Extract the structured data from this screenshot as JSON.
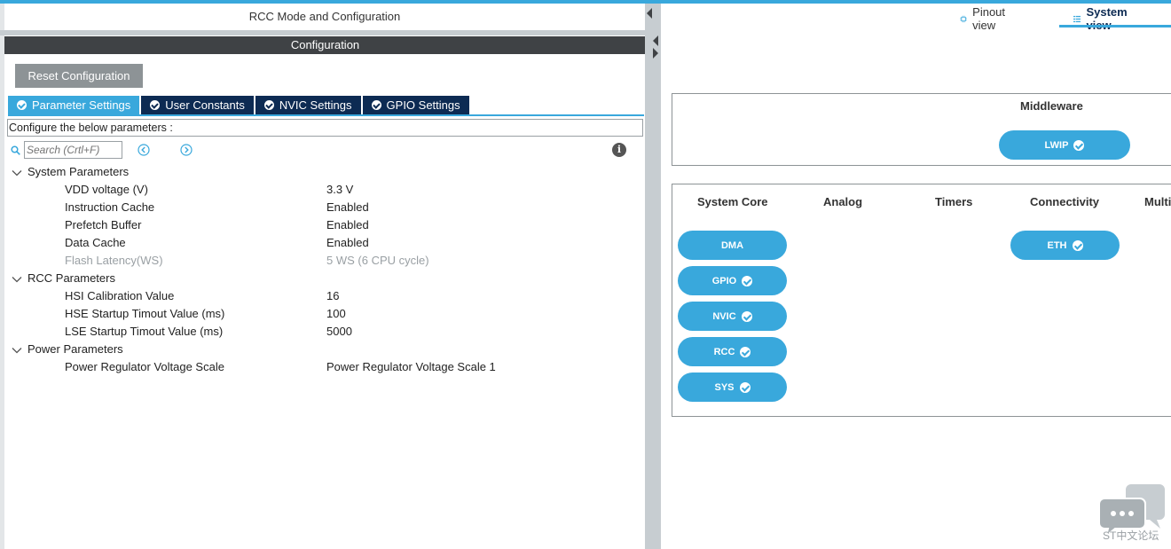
{
  "left_panel": {
    "title": "RCC Mode and Configuration",
    "config_header": "Configuration",
    "reset_button": "Reset Configuration",
    "tabs": [
      {
        "label": "Parameter Settings",
        "active": true
      },
      {
        "label": "User Constants",
        "active": false
      },
      {
        "label": "NVIC Settings",
        "active": false
      },
      {
        "label": "GPIO Settings",
        "active": false
      }
    ],
    "description": "Configure the below parameters :",
    "search_placeholder": "Search (Crtl+F)",
    "groups": [
      {
        "label": "System Parameters",
        "params": [
          {
            "name": "VDD voltage (V)",
            "value": "3.3 V",
            "disabled": false
          },
          {
            "name": "Instruction Cache",
            "value": "Enabled",
            "disabled": false
          },
          {
            "name": "Prefetch Buffer",
            "value": "Enabled",
            "disabled": false
          },
          {
            "name": "Data Cache",
            "value": "Enabled",
            "disabled": false
          },
          {
            "name": "Flash Latency(WS)",
            "value": "5 WS (6 CPU cycle)",
            "disabled": true
          }
        ]
      },
      {
        "label": "RCC Parameters",
        "params": [
          {
            "name": "HSI Calibration Value",
            "value": "16",
            "disabled": false
          },
          {
            "name": "HSE Startup Timout Value (ms)",
            "value": "100",
            "disabled": false
          },
          {
            "name": "LSE Startup Timout Value (ms)",
            "value": "5000",
            "disabled": false
          }
        ]
      },
      {
        "label": "Power Parameters",
        "params": [
          {
            "name": "Power Regulator Voltage Scale",
            "value": "Power Regulator Voltage Scale 1",
            "disabled": false
          }
        ]
      }
    ]
  },
  "right_panel": {
    "view_tabs": {
      "pinout": "Pinout view",
      "system": "System view"
    },
    "middleware": {
      "title": "Middleware",
      "items": [
        {
          "label": "LWIP",
          "checked": true
        }
      ]
    },
    "categories": [
      {
        "label": "System Core",
        "items": [
          {
            "label": "DMA",
            "checked": false
          },
          {
            "label": "GPIO",
            "checked": true
          },
          {
            "label": "NVIC",
            "checked": true
          },
          {
            "label": "RCC",
            "checked": true
          },
          {
            "label": "SYS",
            "checked": true
          }
        ]
      },
      {
        "label": "Analog",
        "items": []
      },
      {
        "label": "Timers",
        "items": []
      },
      {
        "label": "Connectivity",
        "items": [
          {
            "label": "ETH",
            "checked": true
          }
        ]
      },
      {
        "label": "Multi",
        "items": []
      }
    ],
    "forum_label": "ST中文论坛"
  },
  "colors": {
    "accent": "#39a8dc",
    "dark_tab": "#0d2b53",
    "header_bg": "#3f4245",
    "button_grey": "#8d9396"
  }
}
